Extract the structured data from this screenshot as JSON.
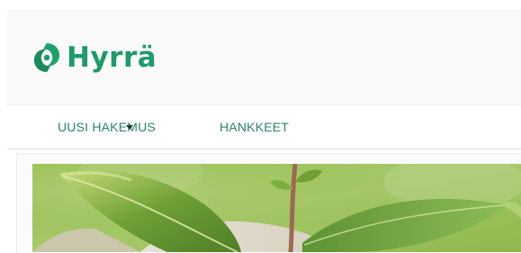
{
  "header": {
    "logo_text": "Hyrrä",
    "logo_icon": "hyrra-logo-icon",
    "brand_color": "#1f9a6a"
  },
  "nav": {
    "items": [
      {
        "label": "UUSI HAKEMUS",
        "has_dropdown": true
      },
      {
        "label": "HANKKEET",
        "has_dropdown": false
      }
    ],
    "text_color": "#2f7f6b"
  },
  "hero": {
    "image": "seedling-in-hand-photo"
  }
}
